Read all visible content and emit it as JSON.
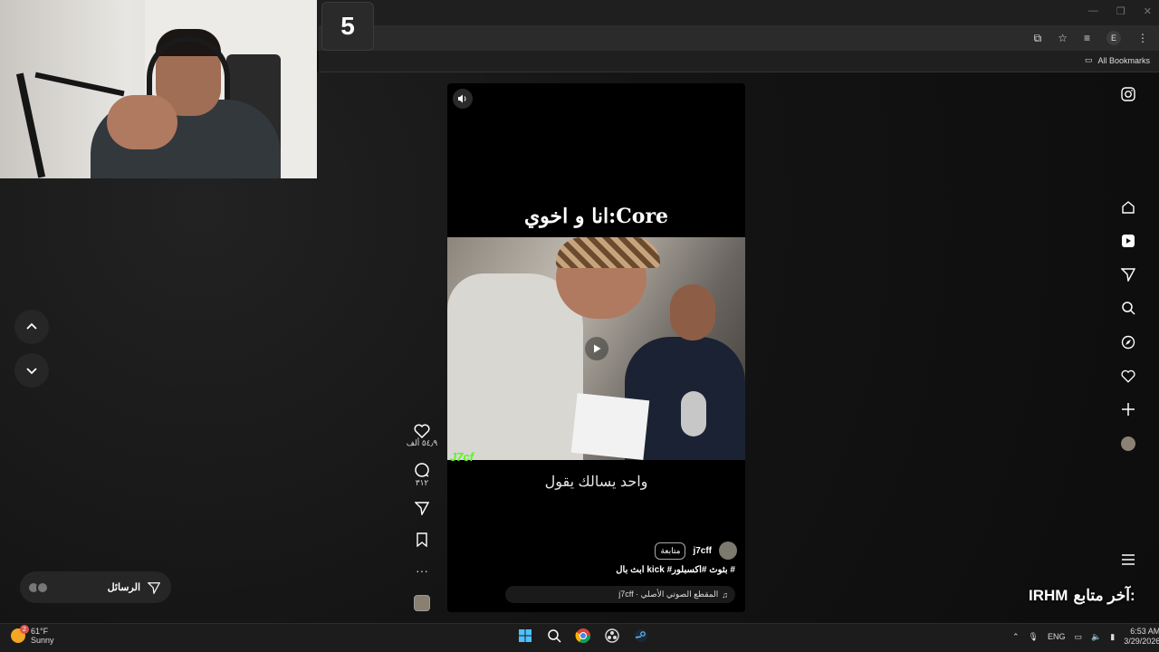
{
  "overlay": {
    "counter": "5",
    "follower_label": "آخر متابع:",
    "follower_name": "IRHM"
  },
  "browser": {
    "bookmarks_label": "All Bookmarks",
    "profile_initial": "E"
  },
  "reel": {
    "caption_top": "انا و اخوي:Core",
    "caption_bottom": "واحد يسالك يقول",
    "kick_tag": "J7cf",
    "author": "j7cff",
    "follow_label": "متابعة",
    "description": "ابث بال kick #بثوث #اكسبلور #",
    "audio": "j7cff · المقطع الصوتي الأصلي",
    "likes": "٥٤٫٩ ألف",
    "comments": "٣١٢"
  },
  "sidebar_icons": [
    "instagram-icon",
    "home-icon",
    "reels-icon",
    "send-icon",
    "search-icon",
    "explore-icon",
    "heart-icon",
    "plus-icon",
    "profile-avatar",
    "menu-icon"
  ],
  "messages": {
    "label": "الرسائل"
  },
  "taskbar": {
    "weather_temp": "61°F",
    "weather_desc": "Sunny",
    "weather_badge": "2",
    "language": "ENG",
    "time": "6:53 AM",
    "date": "3/29/2026"
  },
  "colors": {
    "kick_green": "#53fc18",
    "accent_blue": "#0a84ff"
  }
}
